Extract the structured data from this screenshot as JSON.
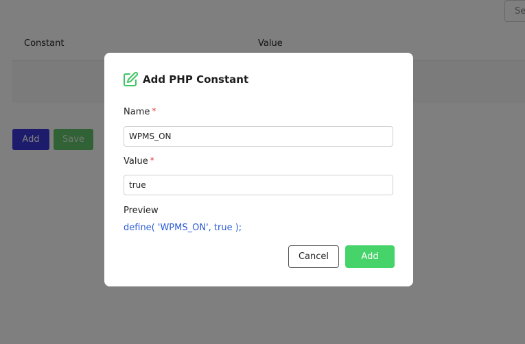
{
  "background": {
    "search_placeholder": "Se",
    "table": {
      "columns": [
        "Constant",
        "Value"
      ]
    },
    "add_label": "Add",
    "save_label": "Save"
  },
  "modal": {
    "title": "Add PHP Constant",
    "icon": "edit-icon",
    "name_label": "Name",
    "value_label": "Value",
    "required_mark": "*",
    "name_value": "WPMS_ON",
    "value_value": "true",
    "preview_label": "Preview",
    "preview_code": "define( 'WPMS_ON', true );",
    "cancel_label": "Cancel",
    "add_label": "Add"
  },
  "colors": {
    "accent_green": "#45d36a",
    "preview_blue": "#2a5bd7",
    "required_red": "#e03131",
    "primary_blue": "#3b37d6"
  }
}
